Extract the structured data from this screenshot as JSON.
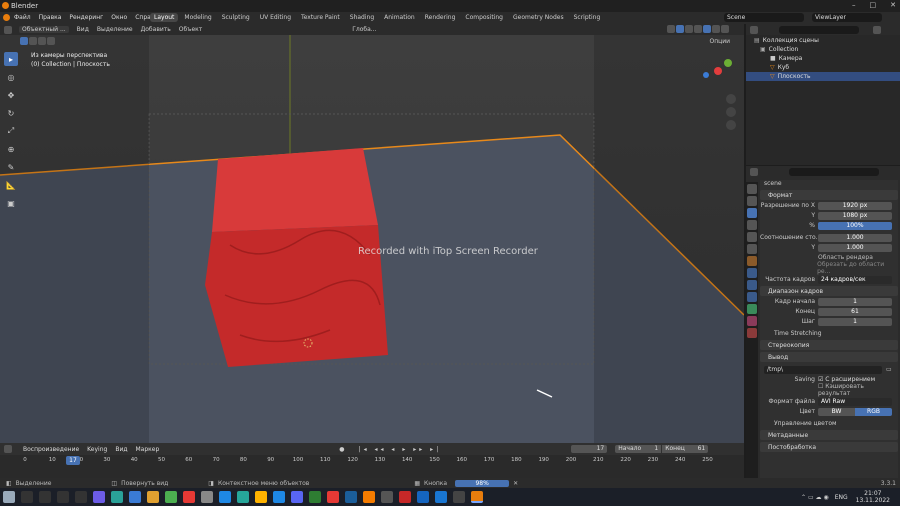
{
  "window": {
    "title": "Blender"
  },
  "menu": [
    "Файл",
    "Правка",
    "Рендеринг",
    "Окно",
    "Справка"
  ],
  "workspaces": [
    "Layout",
    "Modeling",
    "Sculpting",
    "UV Editing",
    "Texture Paint",
    "Shading",
    "Animation",
    "Rendering",
    "Compositing",
    "Geometry Nodes",
    "Scripting"
  ],
  "active_workspace": "Layout",
  "scene_name": "Scene",
  "viewlayer": "ViewLayer",
  "viewport_header": {
    "mode": "Объектный ...",
    "view": "Вид",
    "select": "Выделение",
    "add": "Добавить",
    "object": "Объект",
    "orientation": "Глоба...",
    "options": "Опции"
  },
  "viewport": {
    "line1": "Из камеры перспектива",
    "line2": "(0) Collection | Плоскость",
    "watermark": "Recorded with iTop Screen Recorder"
  },
  "outliner": {
    "root": "Коллекция сцены",
    "collection": "Collection",
    "items": [
      "Камера",
      "Куб",
      "Плоскость"
    ],
    "selected": "Плоскость"
  },
  "properties": {
    "scene_label": "scene",
    "format_section": "Формат",
    "res_x_label": "Разрешение по X",
    "res_x": "1920 px",
    "res_y_label": "Y",
    "res_y": "1080 px",
    "res_pct_label": "%",
    "res_pct": "100%",
    "aspect_label": "Соотношение сто...",
    "aspect_x": "1.000",
    "aspect_y_label": "Y",
    "aspect_y": "1.000",
    "render_region": "Область рендера",
    "crop_region": "Обрезать до области ре...",
    "fps_label": "Частота кадров",
    "fps": "24 кадров/сек",
    "frame_range_section": "Диапазон кадров",
    "frame_start_label": "Кадр начала",
    "frame_start": "1",
    "frame_end_label": "Конец",
    "frame_end": "61",
    "step_label": "Шаг",
    "step": "1",
    "time_stretching": "Time Stretching",
    "stereoscopy": "Стереокопия",
    "output_section": "Вывод",
    "output_path": "/tmp\\",
    "saving_label": "Saving",
    "file_ext": "С расширением",
    "cache": "Кэшировать результат",
    "file_format_label": "Формат файла",
    "file_format": "AVI Raw",
    "color_label": "Цвет",
    "bw": "BW",
    "rgb": "RGB",
    "color_mgmt": "Управление цветом",
    "metadata": "Метаданные",
    "postprocessing": "Постобработка"
  },
  "timeline": {
    "playback": "Воспроизведение",
    "keying": "Keying",
    "view": "Вид",
    "marker": "Маркер",
    "current": "17",
    "start_label": "Начало",
    "start": "1",
    "end_label": "Конец",
    "end": "61",
    "ticks": [
      "0",
      "10",
      "20",
      "30",
      "40",
      "50",
      "60",
      "70",
      "80",
      "90",
      "100",
      "110",
      "120",
      "130",
      "140",
      "150",
      "160",
      "170",
      "180",
      "190",
      "200",
      "210",
      "220",
      "230",
      "240",
      "250"
    ]
  },
  "statusbar": {
    "select": "Выделение",
    "rotate": "Повернуть вид",
    "ctx": "Контекстное меню объектов",
    "render_label": "Кнопка",
    "progress": "98%",
    "version": "3.3.1"
  },
  "taskbar": {
    "lang": "ENG",
    "time": "21:07",
    "date": "13.11.2022"
  }
}
